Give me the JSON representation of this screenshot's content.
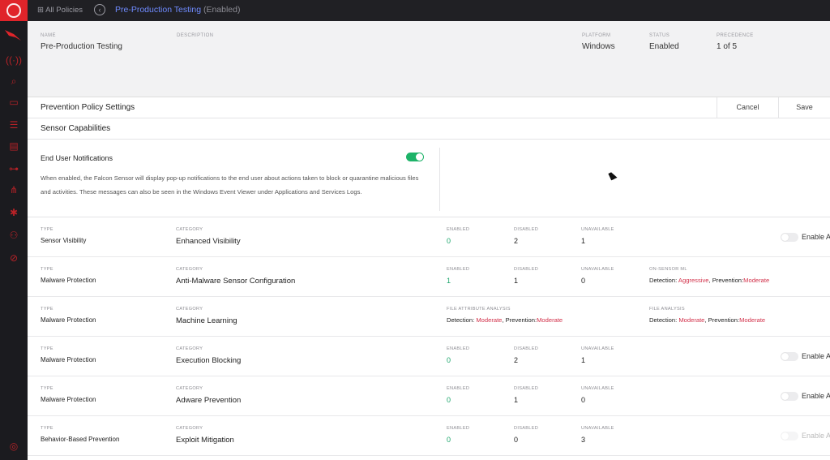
{
  "topbar": {
    "all_policies": "All Policies",
    "policy_name": "Pre-Production Testing",
    "policy_state": "(Enabled)"
  },
  "header": {
    "name_label": "NAME",
    "name_value": "Pre-Production Testing",
    "description_label": "DESCRIPTION",
    "platform_label": "PLATFORM",
    "platform_value": "Windows",
    "status_label": "STATUS",
    "status_value": "Enabled",
    "precedence_label": "PRECEDENCE",
    "precedence_value": "1 of 5"
  },
  "settings": {
    "title": "Prevention Policy Settings",
    "cancel_label": "Cancel",
    "save_label": "Save"
  },
  "sensor": {
    "title": "Sensor Capabilities",
    "notif_title": "End User Notifications",
    "notif_enabled": true,
    "notif_desc": "When enabled, the Falcon Sensor will display pop-up notifications to the end user about actions taken to block or quarantine malicious files and activities. These messages can also be seen in the Windows Event Viewer under Applications and Services Logs."
  },
  "labels": {
    "type": "TYPE",
    "category": "CATEGORY",
    "enabled": "ENABLED",
    "disabled": "DISABLED",
    "unavailable": "UNAVAILABLE",
    "enable_all": "Enable A"
  },
  "rows": [
    {
      "type": "Sensor Visibility",
      "category": "Enhanced Visibility",
      "enabled": "0",
      "disabled": "2",
      "unavailable": "1"
    },
    {
      "type": "Malware Protection",
      "category": "Anti-Malware Sensor Configuration",
      "enabled": "1",
      "disabled": "1",
      "unavailable": "0",
      "extra_label": "ON-SENSOR ML",
      "extra_detection": "Aggressive",
      "extra_prevention": "Moderate"
    },
    {
      "type": "Malware Protection",
      "category": "Machine Learning",
      "fa_label": "FILE ATTRIBUTE ANALYSIS",
      "fa_detection": "Moderate",
      "fa_prevention": "Moderate",
      "fl_label": "FILE ANALYSIS",
      "fl_detection": "Moderate",
      "fl_prevention": "Moderate"
    },
    {
      "type": "Malware Protection",
      "category": "Execution Blocking",
      "enabled": "0",
      "disabled": "2",
      "unavailable": "1"
    },
    {
      "type": "Malware Protection",
      "category": "Adware Prevention",
      "enabled": "0",
      "disabled": "1",
      "unavailable": "0"
    },
    {
      "type": "Behavior-Based Prevention",
      "category": "Exploit Mitigation",
      "enabled": "0",
      "disabled": "0",
      "unavailable": "3"
    }
  ],
  "detection_prefix": "Detection:",
  "prevention_prefix": "Prevention:",
  "colors": {
    "accent_red": "#e0242a",
    "link_blue": "#6f8bff",
    "green": "#1db368",
    "level_red": "#d2314a"
  }
}
